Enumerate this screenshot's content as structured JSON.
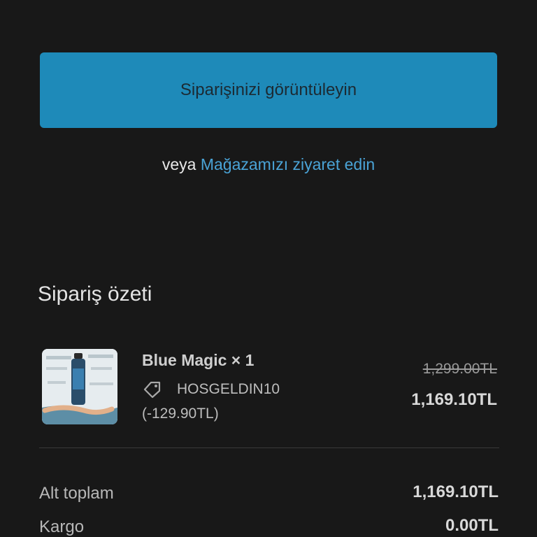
{
  "cta": {
    "view_order": "Siparişinizi görüntüleyin",
    "or_text": "veya",
    "visit_store": "Mağazamızı ziyaret edin"
  },
  "summary": {
    "title": "Sipariş özeti",
    "item": {
      "name": "Blue Magic × 1",
      "discount_code": "HOSGELDIN10",
      "discount_amount": "(-129.90TL)",
      "price_original": "1,299.00TL",
      "price_final": "1,169.10TL",
      "image_icon": "product-thumbnail"
    },
    "subtotal_label": "Alt toplam",
    "subtotal_value": "1,169.10TL",
    "shipping_label": "Kargo",
    "shipping_value": "0.00TL"
  },
  "colors": {
    "background": "#181818",
    "button": "#1e8ab9",
    "link": "#4aa3d6"
  }
}
